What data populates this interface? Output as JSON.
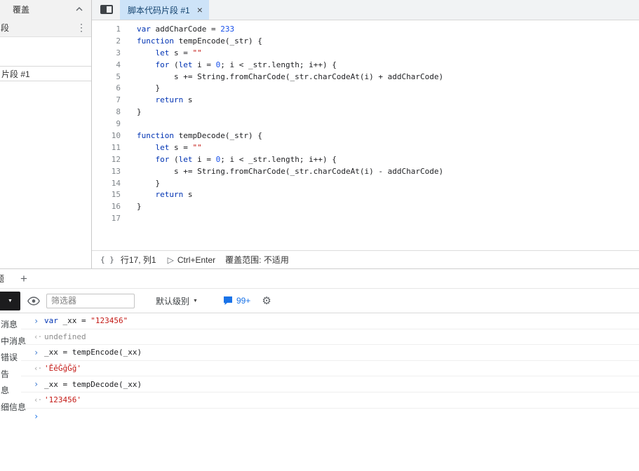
{
  "colors": {
    "accent": "#1a73e8",
    "keyword": "#0033b3",
    "number": "#1750eb",
    "string": "#c41a16",
    "active_tab_bg": "#cde3f8"
  },
  "icons": {
    "kebab": "⋮",
    "add": "+",
    "dropdown": "▼",
    "play": "▷",
    "braces": "{ }",
    "gear": "⚙",
    "input_marker": "›",
    "output_marker": "‹·",
    "prompt_marker": "›"
  },
  "navigator": {
    "overrides_tab": "覆盖",
    "partial_tab": "段",
    "snippet_item": "片段 #1"
  },
  "editor": {
    "tab_label": "脚本代码片段 #1",
    "tab_close": "×",
    "status": {
      "line_col": "行17, 列1",
      "run_hint": "Ctrl+Enter",
      "coverage": "覆盖范围: 不适用"
    },
    "code_lines": [
      [
        [
          "kw",
          "var"
        ],
        [
          "pl",
          " addCharCode = "
        ],
        [
          "num",
          "233"
        ]
      ],
      [
        [
          "kw",
          "function"
        ],
        [
          "pl",
          " tempEncode(_str) {"
        ]
      ],
      [
        [
          "pl",
          "    "
        ],
        [
          "kw",
          "let"
        ],
        [
          "pl",
          " s = "
        ],
        [
          "str",
          "\"\""
        ]
      ],
      [
        [
          "pl",
          "    "
        ],
        [
          "kw",
          "for"
        ],
        [
          "pl",
          " ("
        ],
        [
          "kw",
          "let"
        ],
        [
          "pl",
          " i = "
        ],
        [
          "num",
          "0"
        ],
        [
          "pl",
          "; i < _str.length; i++) {"
        ]
      ],
      [
        [
          "pl",
          "        s += String.fromCharCode(_str.charCodeAt(i) + addCharCode)"
        ]
      ],
      [
        [
          "pl",
          "    }"
        ]
      ],
      [
        [
          "pl",
          "    "
        ],
        [
          "kw",
          "return"
        ],
        [
          "pl",
          " s"
        ]
      ],
      [
        [
          "pl",
          "}"
        ]
      ],
      [],
      [
        [
          "kw",
          "function"
        ],
        [
          "pl",
          " tempDecode(_str) {"
        ]
      ],
      [
        [
          "pl",
          "    "
        ],
        [
          "kw",
          "let"
        ],
        [
          "pl",
          " s = "
        ],
        [
          "str",
          "\"\""
        ]
      ],
      [
        [
          "pl",
          "    "
        ],
        [
          "kw",
          "for"
        ],
        [
          "pl",
          " ("
        ],
        [
          "kw",
          "let"
        ],
        [
          "pl",
          " i = "
        ],
        [
          "num",
          "0"
        ],
        [
          "pl",
          "; i < _str.length; i++) {"
        ]
      ],
      [
        [
          "pl",
          "        s += String.fromCharCode(_str.charCodeAt(i) - addCharCode)"
        ]
      ],
      [
        [
          "pl",
          "    }"
        ]
      ],
      [
        [
          "pl",
          "    "
        ],
        [
          "kw",
          "return"
        ],
        [
          "pl",
          " s"
        ]
      ],
      [
        [
          "pl",
          "}"
        ]
      ],
      []
    ]
  },
  "drawer": {
    "partial_tab": "题"
  },
  "console": {
    "toolbar": {
      "filter_placeholder": "筛选器",
      "level_label": "默认级别",
      "badge_count": "99+"
    },
    "sidebar_items": [
      "消息",
      "中消息",
      "错误",
      "告",
      "息",
      "细信息"
    ],
    "rows": [
      {
        "kind": "input",
        "tokens": [
          [
            "kw",
            "var"
          ],
          [
            "pl",
            " _xx = "
          ],
          [
            "str",
            "\"123456\""
          ]
        ]
      },
      {
        "kind": "output",
        "tokens": [
          [
            "muted",
            "undefined"
          ]
        ]
      },
      {
        "kind": "input",
        "tokens": [
          [
            "pl",
            "_xx = tempEncode(_xx)"
          ]
        ]
      },
      {
        "kind": "output",
        "tokens": [
          [
            "str",
            "'ĚěĜĝĞğ'"
          ]
        ]
      },
      {
        "kind": "input",
        "tokens": [
          [
            "pl",
            "_xx = tempDecode(_xx)"
          ]
        ]
      },
      {
        "kind": "output",
        "tokens": [
          [
            "str",
            "'123456'"
          ]
        ]
      },
      {
        "kind": "prompt",
        "tokens": []
      }
    ]
  }
}
